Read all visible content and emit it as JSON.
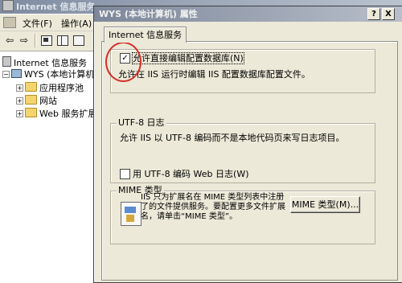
{
  "background_window": {
    "title": "Internet 信息服务",
    "menu": [
      {
        "label": "文件(F)"
      },
      {
        "label": "操作(A)"
      }
    ],
    "tree": {
      "root_label": "Internet 信息服务",
      "computer_label": "WYS (本地计算机)",
      "children": [
        {
          "label": "应用程序池"
        },
        {
          "label": "网站"
        },
        {
          "label": "Web 服务扩展"
        }
      ]
    }
  },
  "dialog": {
    "title": "WYS (本地计算机) 属性",
    "help_button": "?",
    "close_button": "X",
    "tab_label": "Internet 信息服务",
    "direct_edit": {
      "checkbox_label": "允许直接编辑配置数据库(N)",
      "checked": true,
      "description": "允许在 IIS 运行时编辑 IIS 配置数据库配置文件。"
    },
    "utf8_log": {
      "group_title": "UTF-8 日志",
      "description": "允许 IIS 以 UTF-8 编码而不是本地代码页来写日志项目。",
      "checkbox_label": "用 UTF-8 编码 Web 日志(W)",
      "checked": false
    },
    "mime": {
      "group_title": "MIME 类型",
      "description": "IIS 只为扩展名在 MIME 类型列表中注册了的文件提供服务。要配置更多文件扩展名，请单击“MIME 类型”。",
      "button_label": "MIME 类型(M)..."
    }
  },
  "colors": {
    "dialog_face": "#ece9d8",
    "title_bar": "#7d879a",
    "annotation_circle": "#d4312a"
  }
}
